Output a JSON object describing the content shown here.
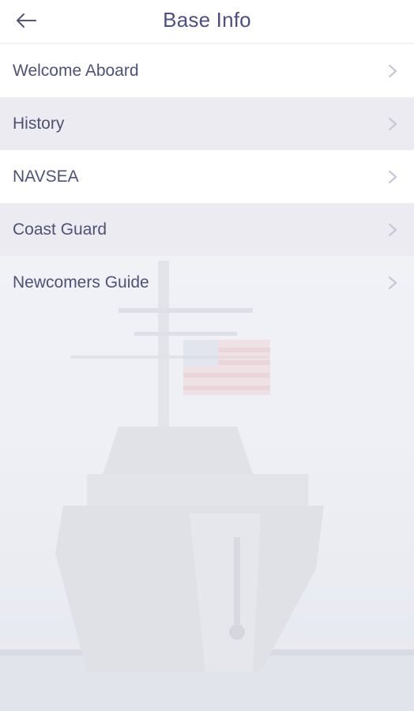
{
  "header": {
    "title": "Base Info",
    "back_icon": "arrow-left-icon"
  },
  "menu": {
    "items": [
      {
        "label": "Welcome Aboard",
        "chevron_icon": "chevron-right-icon"
      },
      {
        "label": "History",
        "chevron_icon": "chevron-right-icon"
      },
      {
        "label": "NAVSEA",
        "chevron_icon": "chevron-right-icon"
      },
      {
        "label": "Coast Guard",
        "chevron_icon": "chevron-right-icon"
      },
      {
        "label": "Newcomers Guide",
        "chevron_icon": "chevron-right-icon"
      }
    ]
  },
  "colors": {
    "title_text": "#4d4f7e",
    "item_text": "#4f5273",
    "row_alt": "#eaeaf0",
    "chevron": "#c7c8d4"
  }
}
